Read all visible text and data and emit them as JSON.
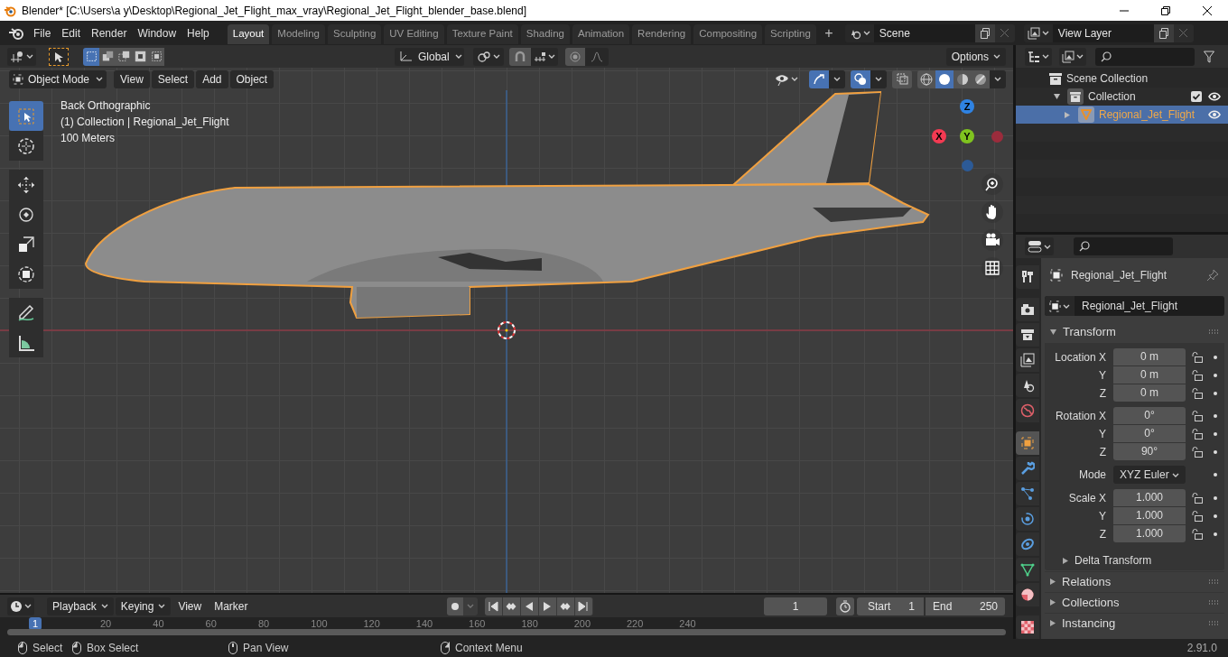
{
  "window": {
    "title": "Blender* [C:\\Users\\a y\\Desktop\\Regional_Jet_Flight_max_vray\\Regional_Jet_Flight_blender_base.blend]"
  },
  "menu": [
    "File",
    "Edit",
    "Render",
    "Window",
    "Help"
  ],
  "workspaces": [
    {
      "label": "Layout",
      "selected": true
    },
    {
      "label": "Modeling",
      "selected": false
    },
    {
      "label": "Sculpting",
      "selected": false
    },
    {
      "label": "UV Editing",
      "selected": false
    },
    {
      "label": "Texture Paint",
      "selected": false
    },
    {
      "label": "Shading",
      "selected": false
    },
    {
      "label": "Animation",
      "selected": false
    },
    {
      "label": "Rendering",
      "selected": false
    },
    {
      "label": "Compositing",
      "selected": false
    },
    {
      "label": "Scripting",
      "selected": false
    }
  ],
  "add_workspace": "+",
  "scene": "Scene",
  "view_layer": "View Layer",
  "tool_header": {
    "select_modes": [
      {
        "selected": true
      },
      {
        "selected": false
      },
      {
        "selected": false
      },
      {
        "selected": false
      },
      {
        "selected": false
      }
    ],
    "orientation": "Global",
    "options": "Options"
  },
  "viewport": {
    "mode": "Object Mode",
    "menus": [
      "View",
      "Select",
      "Add",
      "Object"
    ],
    "info": [
      "Back Orthographic",
      "(1) Collection | Regional_Jet_Flight",
      "100 Meters"
    ],
    "tools": [
      {
        "selected": true
      },
      {
        "selected": false
      },
      {
        "selected": false
      },
      {
        "selected": false
      },
      {
        "selected": false
      },
      {
        "selected": false
      },
      {
        "selected": false
      },
      {
        "selected": false
      }
    ],
    "shading": [
      {
        "selected": false
      },
      {
        "selected": true
      },
      {
        "selected": false
      },
      {
        "selected": false
      }
    ],
    "gizmo": [
      {
        "label": "Z",
        "color": "#2f83e3"
      },
      {
        "label": "X",
        "color": "#f33a52"
      },
      {
        "label": "Y",
        "color": "#7fc31f"
      }
    ]
  },
  "outliner": {
    "items": [
      {
        "label": "Scene Collection",
        "selected": false,
        "children": [
          {
            "label": "Collection",
            "selected": false,
            "expanded": true,
            "checked": true,
            "children": [
              {
                "label": "Regional_Jet_Flight",
                "selected": true,
                "expanded": false
              }
            ]
          }
        ]
      }
    ]
  },
  "properties": {
    "tabs": [
      {
        "selected": false
      },
      {
        "selected": false
      },
      {
        "selected": false
      },
      {
        "selected": false
      },
      {
        "selected": false
      },
      {
        "selected": false
      },
      {
        "selected": true
      },
      {
        "selected": false
      },
      {
        "selected": false
      },
      {
        "selected": false
      },
      {
        "selected": false
      },
      {
        "selected": false
      },
      {
        "selected": false
      },
      {
        "selected": false
      }
    ],
    "object_name": "Regional_Jet_Flight",
    "data_name": "Regional_Jet_Flight",
    "transform": {
      "title": "Transform",
      "expanded": true,
      "sections": [
        {
          "kind": "vector",
          "rows": [
            {
              "label": "Location X",
              "value": "0 m"
            },
            {
              "label": "Y",
              "value": "0 m"
            },
            {
              "label": "Z",
              "value": "0 m"
            }
          ]
        },
        {
          "kind": "vector",
          "rows": [
            {
              "label": "Rotation X",
              "value": "0°"
            },
            {
              "label": "Y",
              "value": "0°"
            },
            {
              "label": "Z",
              "value": "90°"
            }
          ]
        },
        {
          "kind": "dropdown",
          "label": "Mode",
          "value": "XYZ Euler"
        },
        {
          "kind": "vector",
          "rows": [
            {
              "label": "Scale X",
              "value": "1.000"
            },
            {
              "label": "Y",
              "value": "1.000"
            },
            {
              "label": "Z",
              "value": "1.000"
            }
          ]
        }
      ],
      "subpanel": {
        "title": "Delta Transform",
        "expanded": false
      }
    },
    "panels": [
      {
        "title": "Relations",
        "expanded": false
      },
      {
        "title": "Collections",
        "expanded": false
      },
      {
        "title": "Instancing",
        "expanded": false
      }
    ]
  },
  "timeline": {
    "menus": [
      "Playback",
      "Keying",
      "View",
      "Marker"
    ],
    "current_frame": "1",
    "start_label": "Start",
    "start": "1",
    "end_label": "End",
    "end": "250",
    "ruler": [
      {
        "label": "1",
        "selected": true
      },
      {
        "label": "20",
        "selected": false
      },
      {
        "label": "40",
        "selected": false
      },
      {
        "label": "60",
        "selected": false
      },
      {
        "label": "80",
        "selected": false
      },
      {
        "label": "100",
        "selected": false
      },
      {
        "label": "120",
        "selected": false
      },
      {
        "label": "140",
        "selected": false
      },
      {
        "label": "160",
        "selected": false
      },
      {
        "label": "180",
        "selected": false
      },
      {
        "label": "200",
        "selected": false
      },
      {
        "label": "220",
        "selected": false
      },
      {
        "label": "240",
        "selected": false
      }
    ]
  },
  "status_bar": {
    "items": [
      {
        "label": "Select"
      },
      {
        "label": "Box Select"
      },
      {
        "label": "Pan View"
      },
      {
        "label": "Context Menu"
      }
    ],
    "version": "2.91.0"
  }
}
